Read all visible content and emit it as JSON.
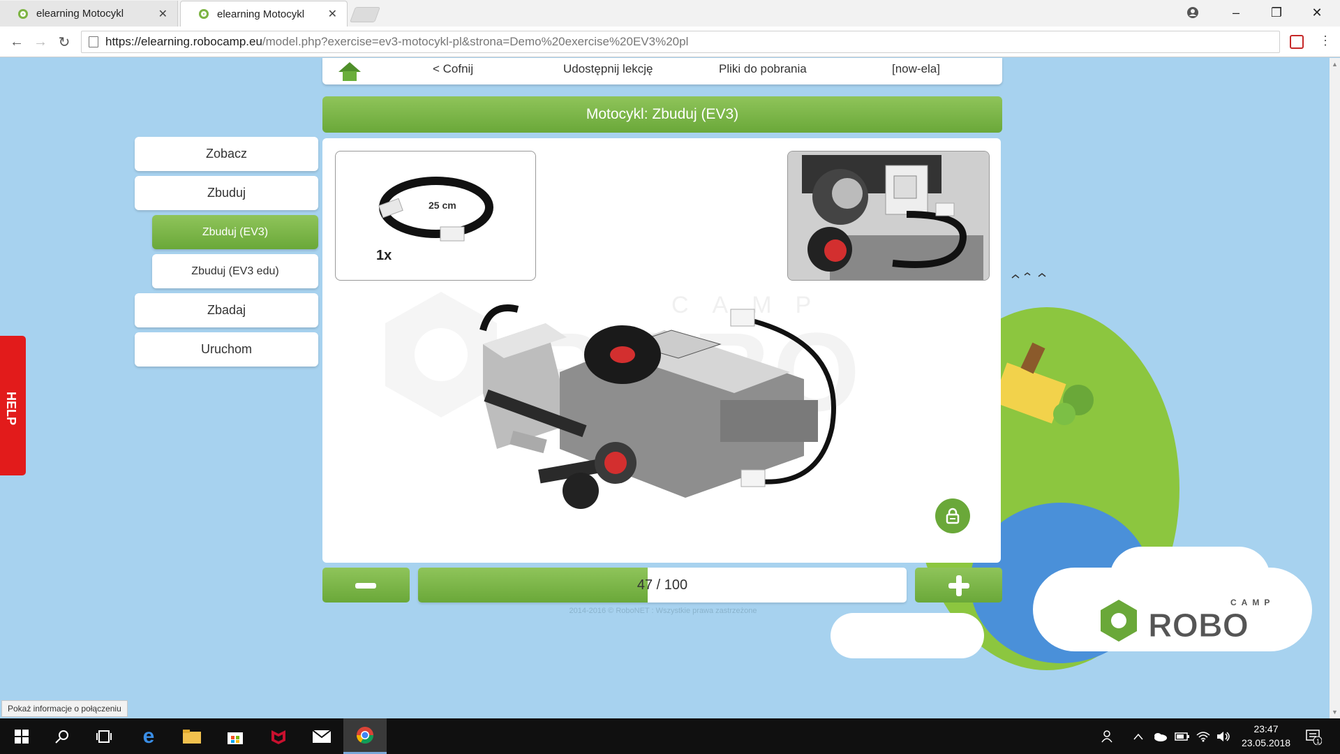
{
  "browser": {
    "tabs": [
      {
        "title": "elearning Motocykl",
        "active": false
      },
      {
        "title": "elearning Motocykl",
        "active": true
      }
    ],
    "url_host": "https://elearning.robocamp.eu",
    "url_path": "/model.php?exercise=ev3-motocykl-pl&strona=Demo%20exercise%20EV3%20pl",
    "window_controls": {
      "minimize": "–",
      "restore": "❐",
      "close": "✕"
    }
  },
  "topnav": {
    "back": "< Cofnij",
    "share": "Udostępnij lekcję",
    "downloads": "Pliki do pobrania",
    "user": "[now-ela]"
  },
  "title": "Motocykl: Zbuduj (EV3)",
  "sidebar": {
    "items": [
      {
        "label": "Zobacz"
      },
      {
        "label": "Zbuduj"
      },
      {
        "label": "Zbuduj (EV3)",
        "active": true
      },
      {
        "label": "Zbuduj (EV3 edu)"
      },
      {
        "label": "Zbadaj"
      },
      {
        "label": "Uruchom"
      }
    ]
  },
  "help": "HELP",
  "parts": {
    "quantity": "1x",
    "cable_length": "25 cm"
  },
  "watermark": {
    "camp": "CAMP",
    "robo": "ROBO"
  },
  "progress": {
    "current": 47,
    "total": 100,
    "text": "47 / 100"
  },
  "footer": "2014-2016 © RoboNET : Wszystkie prawa zastrzeżone",
  "logo": {
    "camp": "CAMP",
    "robo": "ROBO"
  },
  "status_bubble": "Pokaż informacje o połączeniu",
  "taskbar": {
    "time": "23:47",
    "date": "23.05.2018",
    "notifications": "1"
  },
  "colors": {
    "accent_green": "#6aa839",
    "help_red": "#e21b1b",
    "sky": "#a7d2ef"
  }
}
